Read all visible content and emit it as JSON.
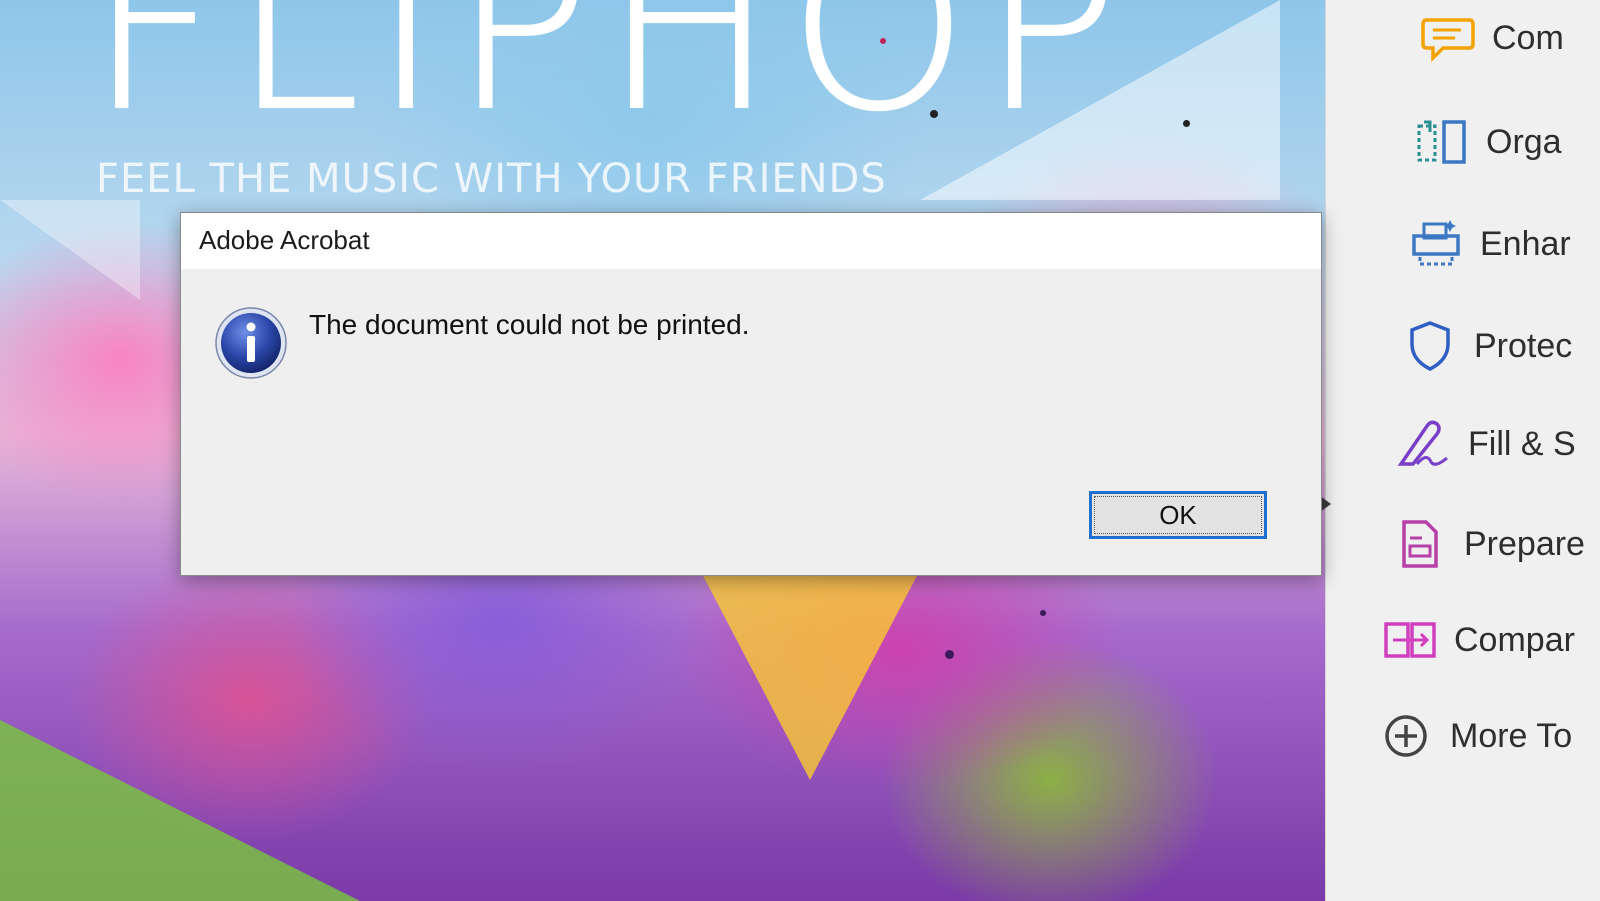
{
  "document": {
    "title": "FLIPHOP",
    "tagline": "FEEL THE MUSIC WITH YOUR FRIENDS"
  },
  "dialog": {
    "title": "Adobe Acrobat",
    "message": "The document could not be printed.",
    "ok_label": "OK",
    "icon": "info-icon"
  },
  "tools_pane": {
    "items": [
      {
        "label": "Com",
        "icon": "comment-icon",
        "color": "#f2a300"
      },
      {
        "label": "Orga",
        "icon": "organize-pages-icon",
        "color": "#2a8f8f"
      },
      {
        "label": "Enhar",
        "icon": "enhance-scans-icon",
        "color": "#3b78c4"
      },
      {
        "label": "Protec",
        "icon": "protect-shield-icon",
        "color": "#2f5fc4"
      },
      {
        "label": "Fill & S",
        "icon": "fill-sign-icon",
        "color": "#7a3fc8"
      },
      {
        "label": "Prepare",
        "icon": "prepare-form-icon",
        "color": "#b63fa8"
      },
      {
        "label": "Compar",
        "icon": "compare-files-icon",
        "color": "#d23fbe"
      },
      {
        "label": "More To",
        "icon": "more-tools-plus-icon",
        "color": "#444444"
      }
    ]
  },
  "colors": {
    "dialog_bg": "#f0f0f0",
    "ok_border": "#1e6fd0",
    "info_icon_blue": "#2a46a8"
  }
}
